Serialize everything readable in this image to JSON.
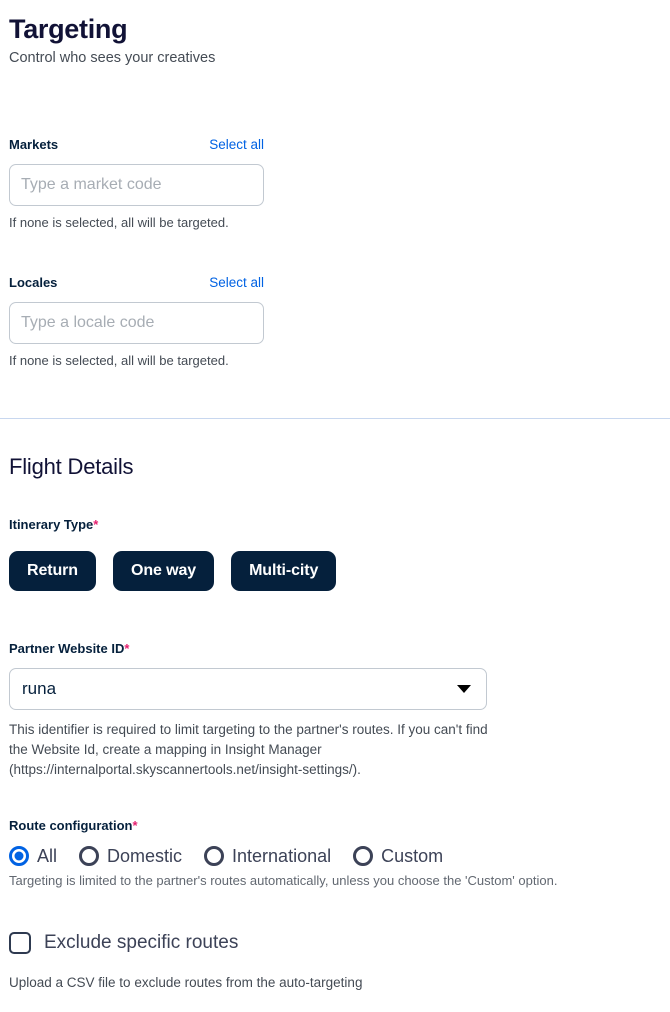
{
  "header": {
    "title": "Targeting",
    "subtitle": "Control who sees your creatives"
  },
  "markets": {
    "label": "Markets",
    "select_all": "Select all",
    "placeholder": "Type a market code",
    "value": "",
    "helper": "If none is selected, all will be targeted."
  },
  "locales": {
    "label": "Locales",
    "select_all": "Select all",
    "placeholder": "Type a locale code",
    "value": "",
    "helper": "If none is selected, all will be targeted."
  },
  "flight_details": {
    "title": "Flight Details",
    "itinerary": {
      "label": "Itinerary Type",
      "required_marker": "*",
      "options": [
        {
          "label": "Return"
        },
        {
          "label": "One way"
        },
        {
          "label": "Multi-city"
        }
      ]
    },
    "partner_website": {
      "label": "Partner Website ID",
      "required_marker": "*",
      "selected": "runa",
      "help": "This identifier is required to limit targeting to the partner's routes. If you can't find the Website Id, create a mapping in Insight Manager (https://internalportal.skyscannertools.net/insight-settings/)."
    },
    "route_configuration": {
      "label": "Route configuration",
      "required_marker": "*",
      "options": [
        {
          "label": "All",
          "selected": true
        },
        {
          "label": "Domestic",
          "selected": false
        },
        {
          "label": "International",
          "selected": false
        },
        {
          "label": "Custom",
          "selected": false
        }
      ],
      "help": "Targeting is limited to the partner's routes automatically, unless you choose the 'Custom' option."
    },
    "exclude_routes": {
      "label": "Exclude specific routes",
      "checked": false,
      "help": "Upload a CSV file to exclude routes from the auto-targeting"
    }
  },
  "colors": {
    "accent_blue": "#0062e3",
    "navy": "#05203c",
    "required_pink": "#e5206f",
    "divider": "#c8d7ef"
  }
}
